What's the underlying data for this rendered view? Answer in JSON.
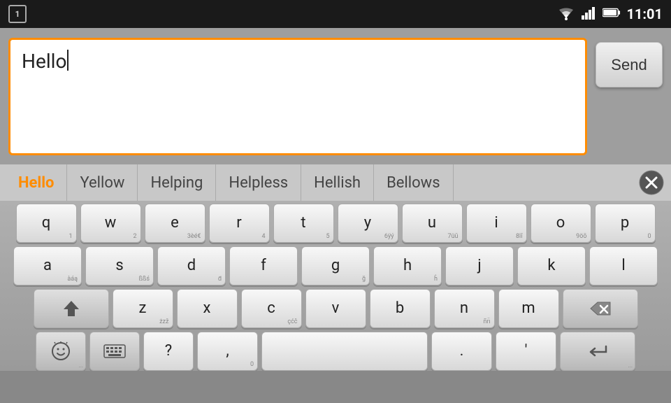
{
  "statusBar": {
    "notificationNumber": "1",
    "time": "11:01"
  },
  "inputArea": {
    "text": "Hello",
    "sendLabel": "Send"
  },
  "suggestions": [
    {
      "text": "Hello",
      "highlight": true
    },
    {
      "text": "Yellow",
      "highlight": false
    },
    {
      "text": "Helping",
      "highlight": false
    },
    {
      "text": "Helpless",
      "highlight": false
    },
    {
      "text": "Hellish",
      "highlight": false
    },
    {
      "text": "Bellows",
      "highlight": false
    }
  ],
  "keyboard": {
    "row1": [
      {
        "main": "q",
        "sub": "1"
      },
      {
        "main": "w",
        "sub": "2"
      },
      {
        "main": "e",
        "sub": "3èé€"
      },
      {
        "main": "r",
        "sub": "4"
      },
      {
        "main": "t",
        "sub": "5"
      },
      {
        "main": "y",
        "sub": "6ÿý"
      },
      {
        "main": "u",
        "sub": "7üū"
      },
      {
        "main": "i",
        "sub": "8ïī"
      },
      {
        "main": "o",
        "sub": "9öō"
      },
      {
        "main": "p",
        "sub": "0"
      }
    ],
    "row2": [
      {
        "main": "a",
        "sub": "àáą"
      },
      {
        "main": "s",
        "sub": "ßßś"
      },
      {
        "main": "d",
        "sub": "d̄"
      },
      {
        "main": "f",
        "sub": ""
      },
      {
        "main": "g",
        "sub": "ğ"
      },
      {
        "main": "h",
        "sub": "ĥ"
      },
      {
        "main": "j",
        "sub": ""
      },
      {
        "main": "k",
        "sub": ""
      },
      {
        "main": "l",
        "sub": ""
      }
    ],
    "row3": [
      {
        "main": "z",
        "sub": "żzž"
      },
      {
        "main": "x",
        "sub": ""
      },
      {
        "main": "c",
        "sub": "çćč"
      },
      {
        "main": "v",
        "sub": ""
      },
      {
        "main": "b",
        "sub": ""
      },
      {
        "main": "n",
        "sub": "ñn̈"
      },
      {
        "main": "m",
        "sub": ""
      }
    ],
    "row4": [
      {
        "main": "?",
        "sub": ""
      },
      {
        "main": ",",
        "sub": "0"
      },
      {
        "main": " ",
        "sub": ""
      },
      {
        "main": ".",
        "sub": ""
      },
      {
        "main": "'",
        "sub": ""
      }
    ]
  }
}
